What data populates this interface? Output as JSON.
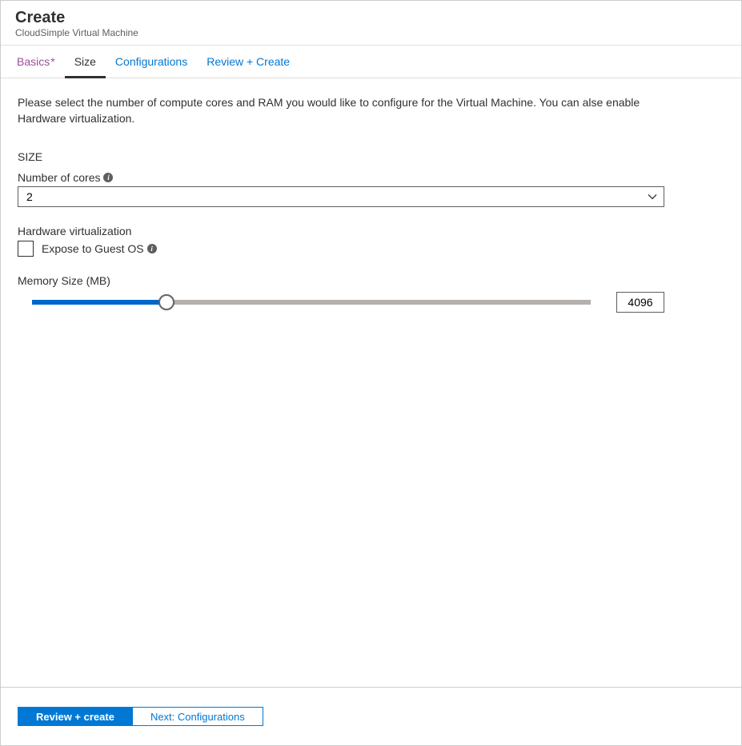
{
  "header": {
    "title": "Create",
    "subtitle": "CloudSimple Virtual Machine"
  },
  "tabs": [
    {
      "label": "Basics",
      "asterisk": "*",
      "state": "visited"
    },
    {
      "label": "Size",
      "state": "active"
    },
    {
      "label": "Configurations",
      "state": "default"
    },
    {
      "label": "Review + Create",
      "state": "default"
    }
  ],
  "content": {
    "intro": "Please select the number of compute cores and RAM you would like to configure for the Virtual Machine. You can alse enable Hardware virtualization.",
    "section_title": "SIZE",
    "cores_label": "Number of cores",
    "cores_value": "2",
    "hw_virtualization_label": "Hardware virtualization",
    "checkbox_label": "Expose to Guest OS",
    "memory_label": "Memory Size (MB)",
    "memory_value": "4096",
    "slider_percent": 24
  },
  "footer": {
    "primary_label": "Review + create",
    "secondary_label": "Next: Configurations"
  }
}
